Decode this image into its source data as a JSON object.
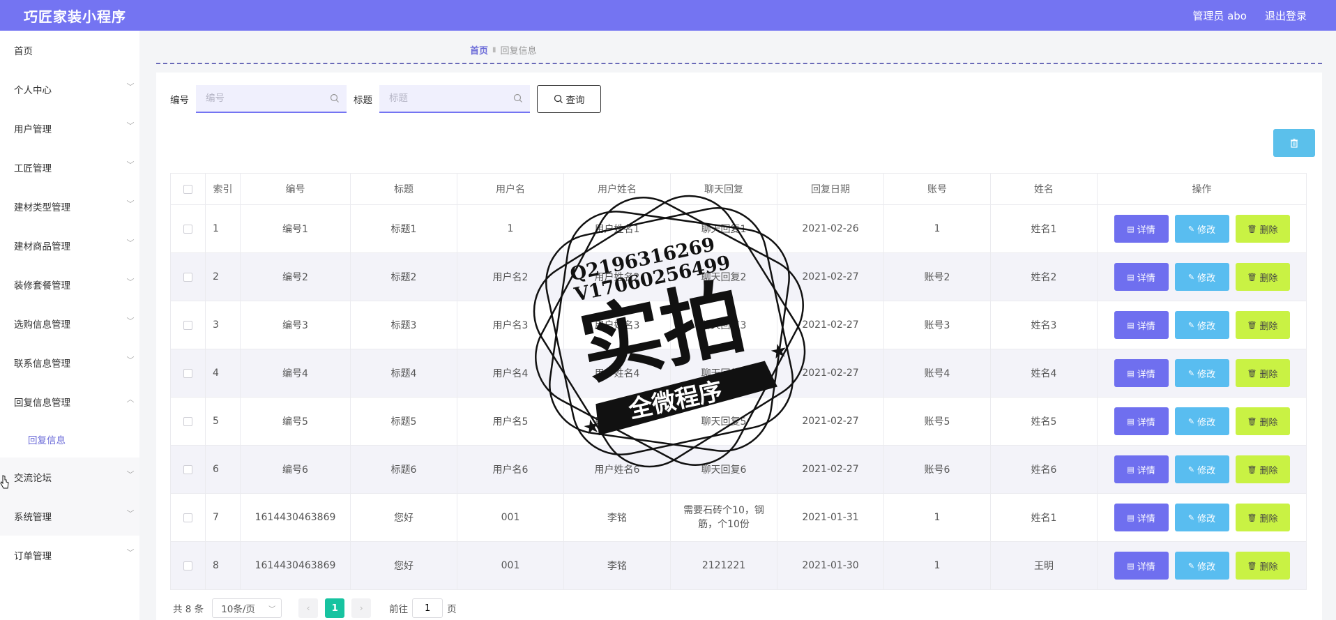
{
  "header": {
    "title": "巧匠家装小程序",
    "user_label": "管理员 abo",
    "logout_label": "退出登录"
  },
  "sidebar": {
    "items": [
      {
        "label": "首页",
        "has_chevron": false
      },
      {
        "label": "个人中心",
        "has_chevron": true
      },
      {
        "label": "用户管理",
        "has_chevron": true
      },
      {
        "label": "工匠管理",
        "has_chevron": true
      },
      {
        "label": "建材类型管理",
        "has_chevron": true
      },
      {
        "label": "建材商品管理",
        "has_chevron": true
      },
      {
        "label": "装修套餐管理",
        "has_chevron": true
      },
      {
        "label": "选购信息管理",
        "has_chevron": true
      },
      {
        "label": "联系信息管理",
        "has_chevron": true
      },
      {
        "label": "回复信息管理",
        "has_chevron": true,
        "expanded": true
      },
      {
        "label": "交流论坛",
        "has_chevron": true
      },
      {
        "label": "系统管理",
        "has_chevron": true
      },
      {
        "label": "订单管理",
        "has_chevron": true
      }
    ],
    "sub_item": "回复信息"
  },
  "breadcrumb": {
    "home": "首页",
    "current": "回复信息"
  },
  "search": {
    "fields": [
      {
        "label": "编号",
        "placeholder": "编号"
      },
      {
        "label": "标题",
        "placeholder": "标题"
      }
    ],
    "query_label": "查询"
  },
  "table": {
    "columns": [
      "索引",
      "编号",
      "标题",
      "用户名",
      "用户姓名",
      "聊天回复",
      "回复日期",
      "账号",
      "姓名",
      "操作"
    ],
    "rows": [
      [
        "1",
        "编号1",
        "标题1",
        "1",
        "用户姓名1",
        "聊天回复1",
        "2021-02-26",
        "1",
        "姓名1"
      ],
      [
        "2",
        "编号2",
        "标题2",
        "用户名2",
        "用户姓名2",
        "聊天回复2",
        "2021-02-27",
        "账号2",
        "姓名2"
      ],
      [
        "3",
        "编号3",
        "标题3",
        "用户名3",
        "用户姓名3",
        "聊天回复3",
        "2021-02-27",
        "账号3",
        "姓名3"
      ],
      [
        "4",
        "编号4",
        "标题4",
        "用户名4",
        "用户姓名4",
        "聊天回复4",
        "2021-02-27",
        "账号4",
        "姓名4"
      ],
      [
        "5",
        "编号5",
        "标题5",
        "用户名5",
        "用户姓名5",
        "聊天回复5",
        "2021-02-27",
        "账号5",
        "姓名5"
      ],
      [
        "6",
        "编号6",
        "标题6",
        "用户名6",
        "用户姓名6",
        "聊天回复6",
        "2021-02-27",
        "账号6",
        "姓名6"
      ],
      [
        "7",
        "1614430463869",
        "您好",
        "001",
        "李铭",
        "需要石砖个10，钢筋，个10份",
        "2021-01-31",
        "1",
        "姓名1"
      ],
      [
        "8",
        "1614430463869",
        "您好",
        "001",
        "李铭",
        "2121221",
        "2021-01-30",
        "1",
        "王明"
      ]
    ],
    "actions": {
      "detail": "详情",
      "edit": "修改",
      "delete": "删除"
    }
  },
  "pagination": {
    "total_text": "共 8 条",
    "page_size": "10条/页",
    "current_page": "1",
    "goto_prefix": "前往",
    "goto_value": "1",
    "goto_suffix": "页"
  },
  "watermark": {
    "contact_q": "Q2196316269",
    "contact_v": "V17060256499",
    "main_text": "实拍",
    "banner_text": "全微程序"
  },
  "colors": {
    "topbar": "#7474f2",
    "detail_button": "#6f6fef",
    "edit_button": "#59bdf0",
    "delete_button": "#c9f244",
    "delete_top_button": "#5bc0eb",
    "active_page": "#17c3a0"
  }
}
